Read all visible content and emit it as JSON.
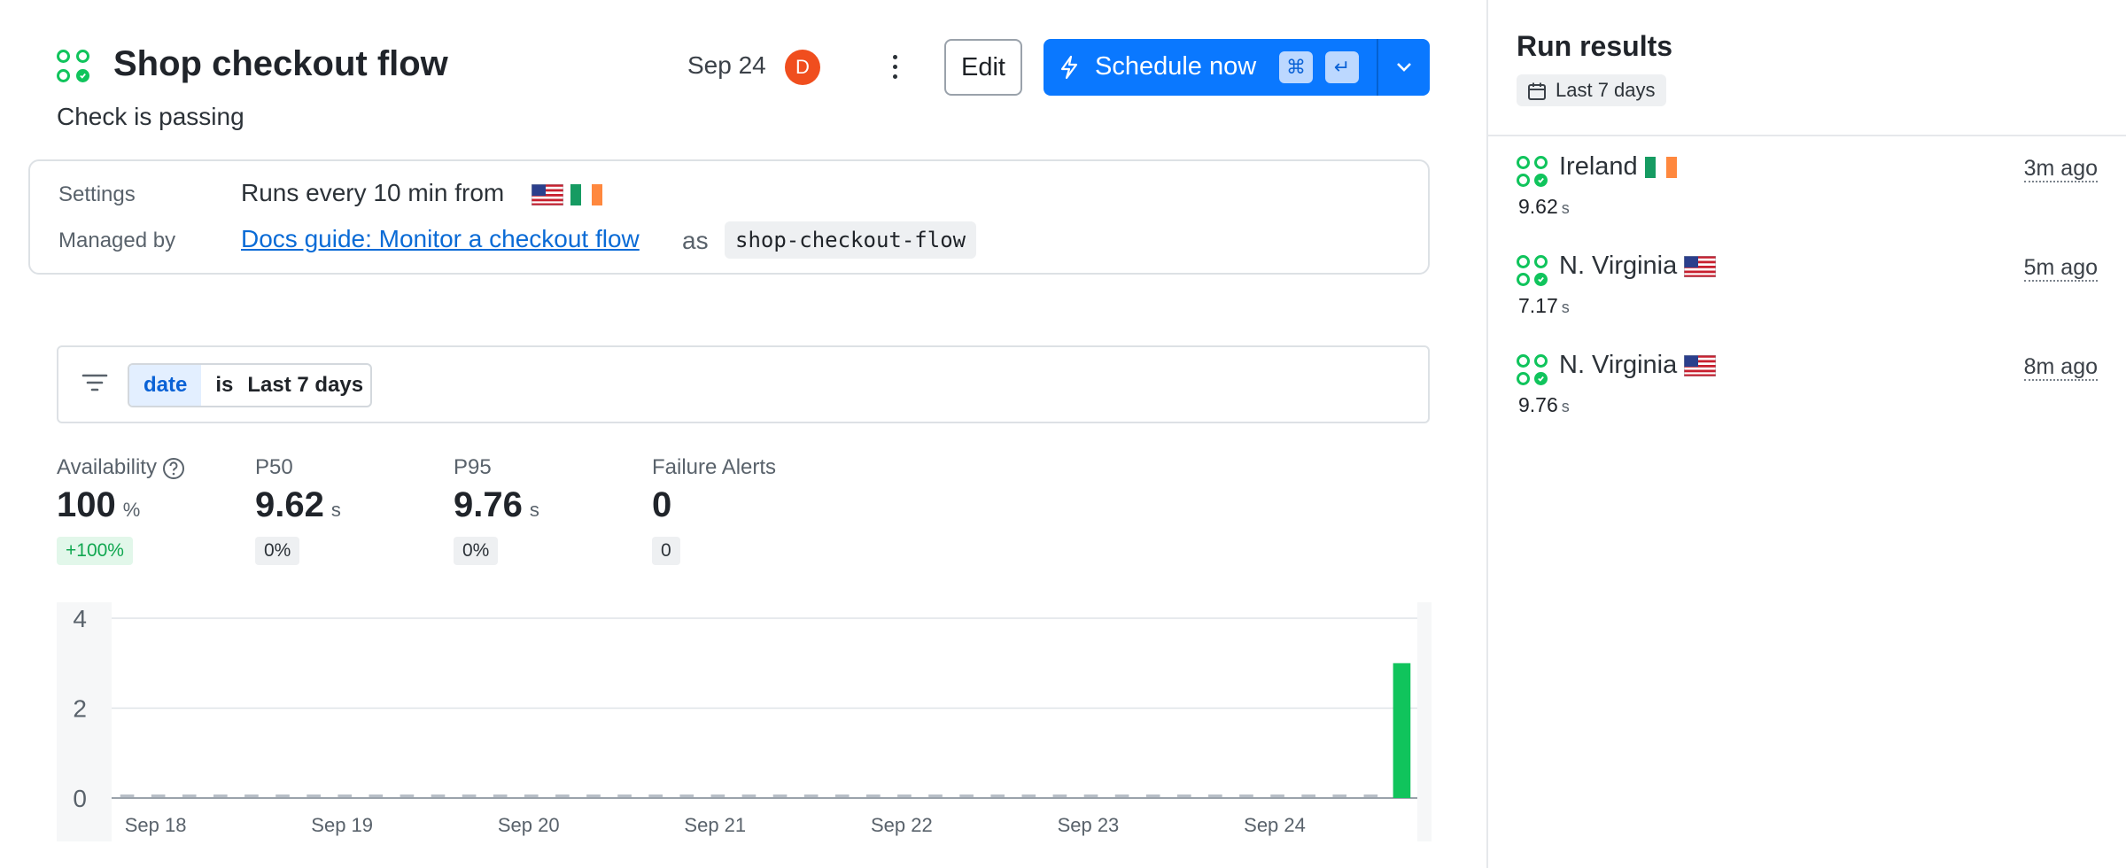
{
  "header": {
    "title": "Shop checkout flow",
    "status": "Check is passing",
    "date": "Sep 24",
    "avatar_initial": "D",
    "edit_label": "Edit",
    "schedule_label": "Schedule now",
    "kbd_cmd": "⌘",
    "kbd_enter": "↵"
  },
  "settings": {
    "settings_label": "Settings",
    "runs_text": "Runs every 10 min from",
    "managed_label": "Managed by",
    "managed_link": "Docs guide: Monitor a checkout flow",
    "as_text": "as",
    "slug": "shop-checkout-flow"
  },
  "filter": {
    "field": "date",
    "operator": "is",
    "value": "Last 7 days"
  },
  "metrics": {
    "availability": {
      "label": "Availability",
      "value": "100",
      "unit": "%",
      "badge": "+100%"
    },
    "p50": {
      "label": "P50",
      "value": "9.62",
      "unit": "s",
      "badge": "0%"
    },
    "p95": {
      "label": "P95",
      "value": "9.76",
      "unit": "s",
      "badge": "0%"
    },
    "failure_alerts": {
      "label": "Failure Alerts",
      "value": "0",
      "badge": "0"
    }
  },
  "chart_data": {
    "type": "bar",
    "ylim": [
      0,
      4
    ],
    "yticks": [
      0,
      2,
      4
    ],
    "xticks": [
      "Sep 18",
      "Sep 19",
      "Sep 20",
      "Sep 21",
      "Sep 22",
      "Sep 23",
      "Sep 24"
    ],
    "bins": 42,
    "values": [
      0,
      0,
      0,
      0,
      0,
      0,
      0,
      0,
      0,
      0,
      0,
      0,
      0,
      0,
      0,
      0,
      0,
      0,
      0,
      0,
      0,
      0,
      0,
      0,
      0,
      0,
      0,
      0,
      0,
      0,
      0,
      0,
      0,
      0,
      0,
      0,
      0,
      0,
      0,
      0,
      0,
      3
    ],
    "colors": {
      "pass": "#10c45c",
      "empty": "#b8bfc7"
    }
  },
  "sidebar": {
    "title": "Run results",
    "range": "Last 7 days",
    "runs": [
      {
        "location": "Ireland",
        "flag": "ie",
        "ago": "3m ago",
        "duration": "9.62",
        "unit": "s"
      },
      {
        "location": "N. Virginia",
        "flag": "us",
        "ago": "5m ago",
        "duration": "7.17",
        "unit": "s"
      },
      {
        "location": "N. Virginia",
        "flag": "us",
        "ago": "8m ago",
        "duration": "9.76",
        "unit": "s"
      }
    ]
  },
  "colors": {
    "accent": "#0a78ff",
    "success": "#10c45c",
    "avatar": "#f04e1e"
  }
}
